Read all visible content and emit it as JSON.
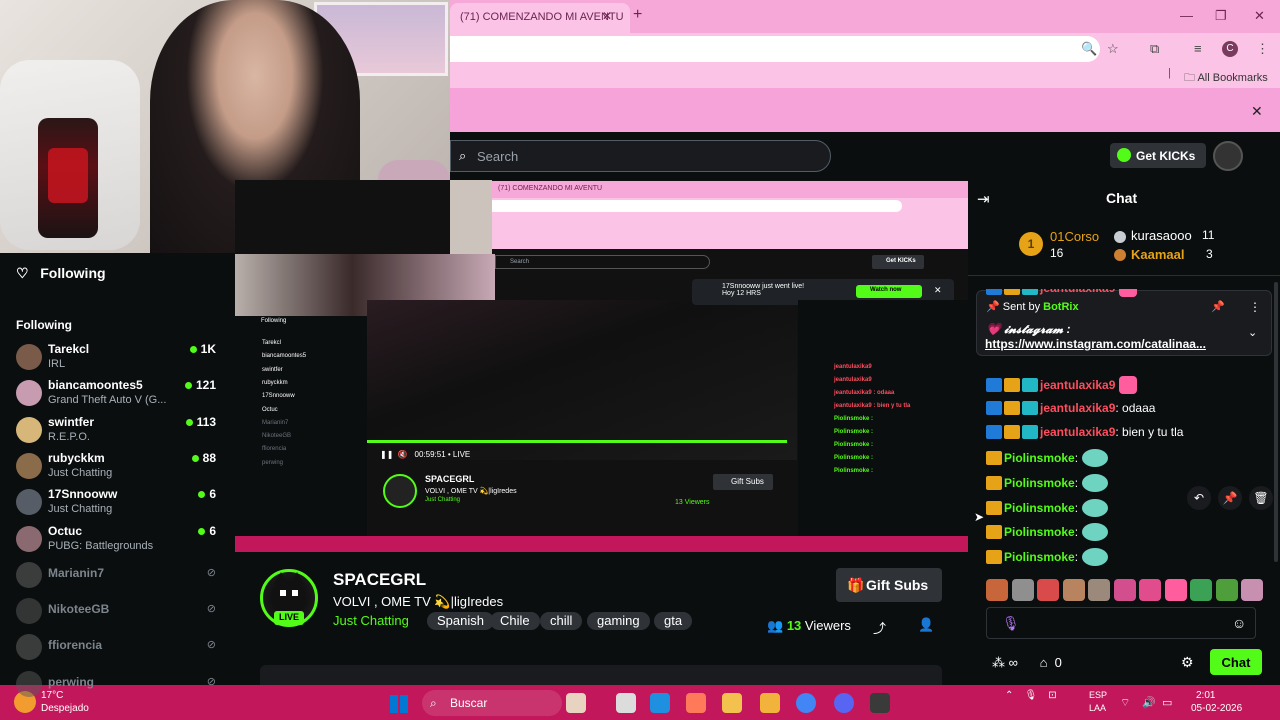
{
  "browser": {
    "tab_title": "(71) COMENZANDO MI AVENTU",
    "all_bookmarks": "All Bookmarks",
    "profile_initial": "C"
  },
  "kick": {
    "search_placeholder": "Search",
    "get_kicks": "Get KICKs",
    "brand_color": "#53fc18"
  },
  "sidebar": {
    "following_top": "Following",
    "following_header": "Following",
    "items": [
      {
        "name": "Tarekcl",
        "category": "IRL",
        "viewers": "1K",
        "live": true
      },
      {
        "name": "biancamoontes5",
        "category": "Grand Theft Auto V (G...",
        "viewers": "121",
        "live": true
      },
      {
        "name": "swintfer",
        "category": "R.E.P.O.",
        "viewers": "113",
        "live": true
      },
      {
        "name": "rubyckkm",
        "category": "Just Chatting",
        "viewers": "88",
        "live": true
      },
      {
        "name": "17Snnooww",
        "category": "Just Chatting",
        "viewers": "6",
        "live": true
      },
      {
        "name": "Octuc",
        "category": "PUBG: Battlegrounds",
        "viewers": "6",
        "live": true
      },
      {
        "name": "Marianin7",
        "category": "",
        "viewers": "",
        "live": false
      },
      {
        "name": "NikoteeGB",
        "category": "",
        "viewers": "",
        "live": false
      },
      {
        "name": "ffiorencia",
        "category": "",
        "viewers": "",
        "live": false
      },
      {
        "name": "perwing",
        "category": "",
        "viewers": "",
        "live": false
      }
    ]
  },
  "nested": {
    "notification": "17Snnooww just went live!",
    "notification_sub": "Hoy 12 HRS",
    "watch_now": "Watch now",
    "time": "00:59:51",
    "live": "LIVE",
    "streamer": "SPACEGRL",
    "gift": "Gift Subs",
    "viewers": "13 Viewers"
  },
  "stream": {
    "name": "SPACEGRL",
    "title": "VOLVI , OME TV 💫|ligIredes",
    "category": "Just Chatting",
    "live_badge": "LIVE",
    "tags": [
      "Spanish",
      "Chile",
      "chill",
      "gaming",
      "gta"
    ],
    "gift_subs": "Gift Subs",
    "viewers_count": "13",
    "viewers_label": "Viewers"
  },
  "chat": {
    "title": "Chat",
    "leaderboard": [
      {
        "rank": "1",
        "name": "01Corso",
        "value": "16"
      },
      {
        "name": "kurasaooo",
        "value": "11"
      },
      {
        "name": "Kaamaal",
        "value": "3"
      }
    ],
    "pinned": {
      "sent_by": "Sent by",
      "sender": "BotRix",
      "text": "💗 𝓲𝓷𝓼𝓽𝓪𝓰𝓻𝓪𝓶 :",
      "link": "https://www.instagram.com/catalinaa..."
    },
    "messages": [
      {
        "user": "jeantulaxika9",
        "text": "",
        "color": "#ff4d5e",
        "badges": [
          "blue",
          "gold",
          "teal"
        ],
        "emote": "pink"
      },
      {
        "user": "jeantulaxika9",
        "text": "",
        "color": "#ff4d5e",
        "badges": [
          "blue",
          "gold",
          "teal"
        ],
        "emote": "pink"
      },
      {
        "user": "jeantulaxika9",
        "text": ": odaaa",
        "color": "#ff4d5e",
        "badges": [
          "blue",
          "gold",
          "teal"
        ],
        "emote": ""
      },
      {
        "user": "jeantulaxika9",
        "text": ": bien y tu tla",
        "color": "#ff4d5e",
        "badges": [
          "blue",
          "gold",
          "teal"
        ],
        "emote": ""
      },
      {
        "user": "Piolinsmoke",
        "text": ":",
        "color": "#53fc18",
        "badges": [
          "gold"
        ],
        "emote": "teal"
      },
      {
        "user": "Piolinsmoke",
        "text": ":",
        "color": "#53fc18",
        "badges": [
          "gold"
        ],
        "emote": "teal"
      },
      {
        "user": "Piolinsmoke",
        "text": ":",
        "color": "#53fc18",
        "badges": [
          "gold"
        ],
        "emote": "teal"
      },
      {
        "user": "Piolinsmoke",
        "text": ":",
        "color": "#53fc18",
        "badges": [
          "gold"
        ],
        "emote": "teal"
      },
      {
        "user": "Piolinsmoke",
        "text": ":",
        "color": "#53fc18",
        "badges": [
          "gold"
        ],
        "emote": "teal"
      }
    ],
    "bottom_count": "0",
    "send": "Chat"
  },
  "taskbar": {
    "temp": "17°C",
    "weather": "Despejado",
    "search": "Buscar",
    "lang1": "ESP",
    "lang2": "LAA",
    "time": "2:01",
    "date": "05-02-2026"
  }
}
